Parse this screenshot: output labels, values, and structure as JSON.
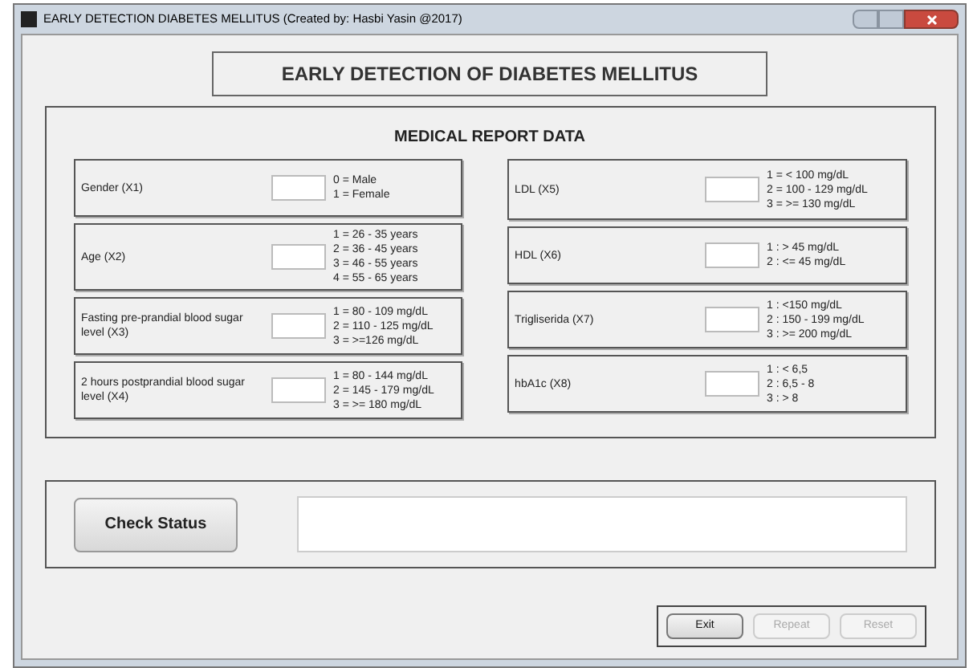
{
  "window": {
    "title": "EARLY DETECTION DIABETES MELLITUS (Created by: Hasbi Yasin @2017)"
  },
  "heading": "EARLY DETECTION OF DIABETES MELLITUS",
  "report": {
    "title": "MEDICAL REPORT DATA",
    "left": [
      {
        "label": "Gender (X1)",
        "legend": [
          "0 = Male",
          "1 = Female"
        ]
      },
      {
        "label": "Age (X2)",
        "legend": [
          "1 = 26 - 35 years",
          "2 = 36 - 45 years",
          "3 = 46 - 55 years",
          "4 = 55 - 65 years"
        ]
      },
      {
        "label": "Fasting pre-prandial blood sugar level (X3)",
        "legend": [
          "1 = 80 - 109 mg/dL",
          "2 = 110 - 125 mg/dL",
          "3 = >=126 mg/dL"
        ]
      },
      {
        "label": "2 hours postprandial blood sugar level (X4)",
        "legend": [
          "1 = 80 - 144 mg/dL",
          "2 = 145 - 179 mg/dL",
          "3 = >= 180 mg/dL"
        ]
      }
    ],
    "right": [
      {
        "label": "LDL (X5)",
        "legend": [
          "1 = < 100 mg/dL",
          "2 = 100 - 129 mg/dL",
          "3 = >= 130 mg/dL"
        ]
      },
      {
        "label": "HDL (X6)",
        "legend": [
          "1 : > 45 mg/dL",
          "2 : <= 45 mg/dL"
        ]
      },
      {
        "label": "Trigliserida (X7)",
        "legend": [
          "1 : <150 mg/dL",
          "2 : 150 - 199 mg/dL",
          "3 : >= 200 mg/dL"
        ]
      },
      {
        "label": "hbA1c (X8)",
        "legend": [
          "1 : < 6,5",
          "2 : 6,5 - 8",
          "3 : > 8"
        ]
      }
    ]
  },
  "check_button": "Check Status",
  "buttons": [
    {
      "label": "Exit",
      "disabled": false
    },
    {
      "label": "Repeat",
      "disabled": true
    },
    {
      "label": "Reset",
      "disabled": true
    }
  ]
}
